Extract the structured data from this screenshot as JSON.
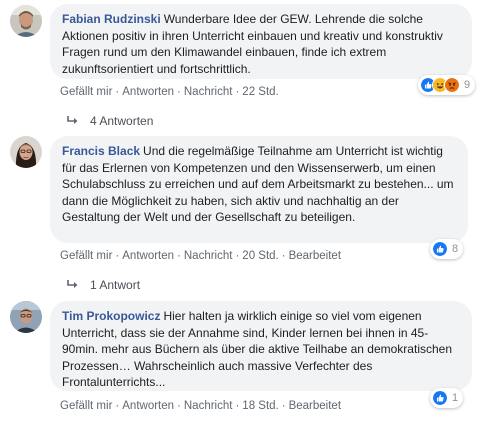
{
  "comments": [
    {
      "author": "Fabian Rudzinski",
      "text": "Wunderbare Idee der GEW. Lehrende die solche Aktionen positiv in ihren Unterricht einbauen und kreativ und konstruktiv Fragen rund um den Klimawandel einbauen, finde ich extrem zukunftsorientiert und fortschrittlich.",
      "actions": {
        "like": "Gefällt mir",
        "reply": "Antworten",
        "message": "Nachricht",
        "time": "22 Std."
      },
      "reaction_count": "9",
      "reaction_icons": [
        "like-icon",
        "haha-icon",
        "angry-icon"
      ],
      "replies_label": "4 Antworten"
    },
    {
      "author": "Francis Black",
      "text": "Und die regelmäßige Teilnahme am Unterricht ist wichtig für das Erlernen von Kompetenzen und den Wissenserwerb, um einen Schulabschluss zu erreichen und auf dem Arbeitsmarkt zu bestehen... um dann die Möglichkeit zu haben, sich aktiv und nachhaltig an der Gestaltung der Welt und der Gesellschaft zu beteiligen.",
      "actions": {
        "like": "Gefällt mir",
        "reply": "Antworten",
        "message": "Nachricht",
        "time": "20 Std.",
        "edited": "Bearbeitet"
      },
      "reaction_count": "8",
      "reaction_icons": [
        "like-icon"
      ],
      "replies_label": "1 Antwort"
    },
    {
      "author": "Tim Prokopowicz",
      "text": "Hier halten ja wirklich einige so viel vom eigenen Unterricht, dass sie der Annahme sind, Kinder lernen bei ihnen in 45-90min. mehr aus Büchern als über die aktive Teilhabe an demokratischen Prozessen… Wahrscheinlich auch massive Verfechter des Frontalunterrichts...",
      "actions": {
        "like": "Gefällt mir",
        "reply": "Antworten",
        "message": "Nachricht",
        "time": "18 Std.",
        "edited": "Bearbeitet"
      },
      "reaction_count": "1",
      "reaction_icons": [
        "like-icon"
      ]
    }
  ],
  "colors": {
    "like": "#1877f2",
    "haha": "#f7b928",
    "angry": "#e9710f",
    "author": "#385898",
    "bubble": "#f2f3f5"
  }
}
